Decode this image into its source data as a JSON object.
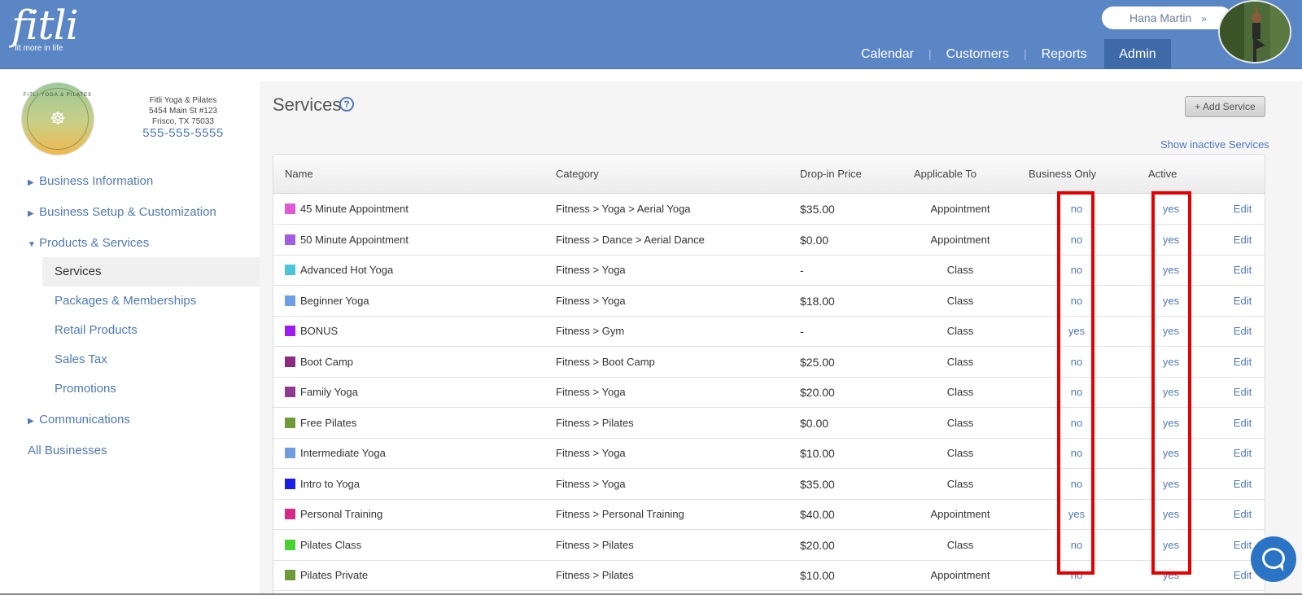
{
  "header": {
    "logo_word": "fitli",
    "logo_tagline": "fit more in life",
    "user_name": "Hana Martin",
    "user_menu_chevron": "»",
    "nav": [
      "Calendar",
      "Customers",
      "Reports",
      "Admin"
    ],
    "nav_active": "Admin"
  },
  "business": {
    "logo_ring_text": "FITLI YOGA & PILATES",
    "name": "Fitli Yoga & Pilates",
    "address_line1": "5454 Main St #123",
    "address_line2": "Frisco, TX 75033",
    "phone": "555-555-5555"
  },
  "sidebar": {
    "items": [
      {
        "label": "Business Information"
      },
      {
        "label": "Business Setup & Customization"
      },
      {
        "label": "Products & Services"
      },
      {
        "label": "Communications"
      },
      {
        "label": "All Businesses"
      }
    ],
    "sub_items": [
      {
        "label": "Services"
      },
      {
        "label": "Packages & Memberships"
      },
      {
        "label": "Retail Products"
      },
      {
        "label": "Sales Tax"
      },
      {
        "label": "Promotions"
      }
    ],
    "active_sub": "Services"
  },
  "main": {
    "title": "Services",
    "help_glyph": "?",
    "add_button": "+ Add Service",
    "show_inactive": "Show inactive Services",
    "columns": [
      "Name",
      "Category",
      "Drop-in Price",
      "Applicable To",
      "Business Only",
      "Active"
    ],
    "edit_label": "Edit",
    "rows": [
      {
        "color": "#e05ad6",
        "name": "45 Minute Appointment",
        "category": "Fitness > Yoga > Aerial Yoga",
        "price": "$35.00",
        "applicable": "Appointment",
        "business_only": "no",
        "active": "yes"
      },
      {
        "color": "#a25ee0",
        "name": "50 Minute Appointment",
        "category": "Fitness > Dance > Aerial Dance",
        "price": "$0.00",
        "applicable": "Appointment",
        "business_only": "no",
        "active": "yes"
      },
      {
        "color": "#4cc5d9",
        "name": "Advanced Hot Yoga",
        "category": "Fitness > Yoga",
        "price": "-",
        "applicable": "Class",
        "business_only": "no",
        "active": "yes"
      },
      {
        "color": "#6fa0e3",
        "name": "Beginner Yoga",
        "category": "Fitness > Yoga",
        "price": "$18.00",
        "applicable": "Class",
        "business_only": "no",
        "active": "yes"
      },
      {
        "color": "#9b1ef0",
        "name": "BONUS",
        "category": "Fitness > Gym",
        "price": "-",
        "applicable": "Class",
        "business_only": "yes",
        "active": "yes"
      },
      {
        "color": "#8b2c7c",
        "name": "Boot Camp",
        "category": "Fitness > Boot Camp",
        "price": "$25.00",
        "applicable": "Class",
        "business_only": "no",
        "active": "yes"
      },
      {
        "color": "#8e3c8e",
        "name": "Family Yoga",
        "category": "Fitness > Yoga",
        "price": "$20.00",
        "applicable": "Class",
        "business_only": "no",
        "active": "yes"
      },
      {
        "color": "#6f9a3a",
        "name": "Free Pilates",
        "category": "Fitness > Pilates",
        "price": "$0.00",
        "applicable": "Class",
        "business_only": "no",
        "active": "yes"
      },
      {
        "color": "#6f9de0",
        "name": "Intermediate Yoga",
        "category": "Fitness > Yoga",
        "price": "$10.00",
        "applicable": "Class",
        "business_only": "no",
        "active": "yes"
      },
      {
        "color": "#1a1ee6",
        "name": "Intro to Yoga",
        "category": "Fitness > Yoga",
        "price": "$35.00",
        "applicable": "Class",
        "business_only": "no",
        "active": "yes"
      },
      {
        "color": "#d62a86",
        "name": "Personal Training",
        "category": "Fitness > Personal Training",
        "price": "$40.00",
        "applicable": "Appointment",
        "business_only": "yes",
        "active": "yes"
      },
      {
        "color": "#49d134",
        "name": "Pilates Class",
        "category": "Fitness > Pilates",
        "price": "$20.00",
        "applicable": "Class",
        "business_only": "no",
        "active": "yes"
      },
      {
        "color": "#6f9a3a",
        "name": "Pilates Private",
        "category": "Fitness > Pilates",
        "price": "$10.00",
        "applicable": "Appointment",
        "business_only": "no",
        "active": "yes"
      }
    ]
  },
  "chat": {
    "icon": "chat-bubble-icon"
  }
}
